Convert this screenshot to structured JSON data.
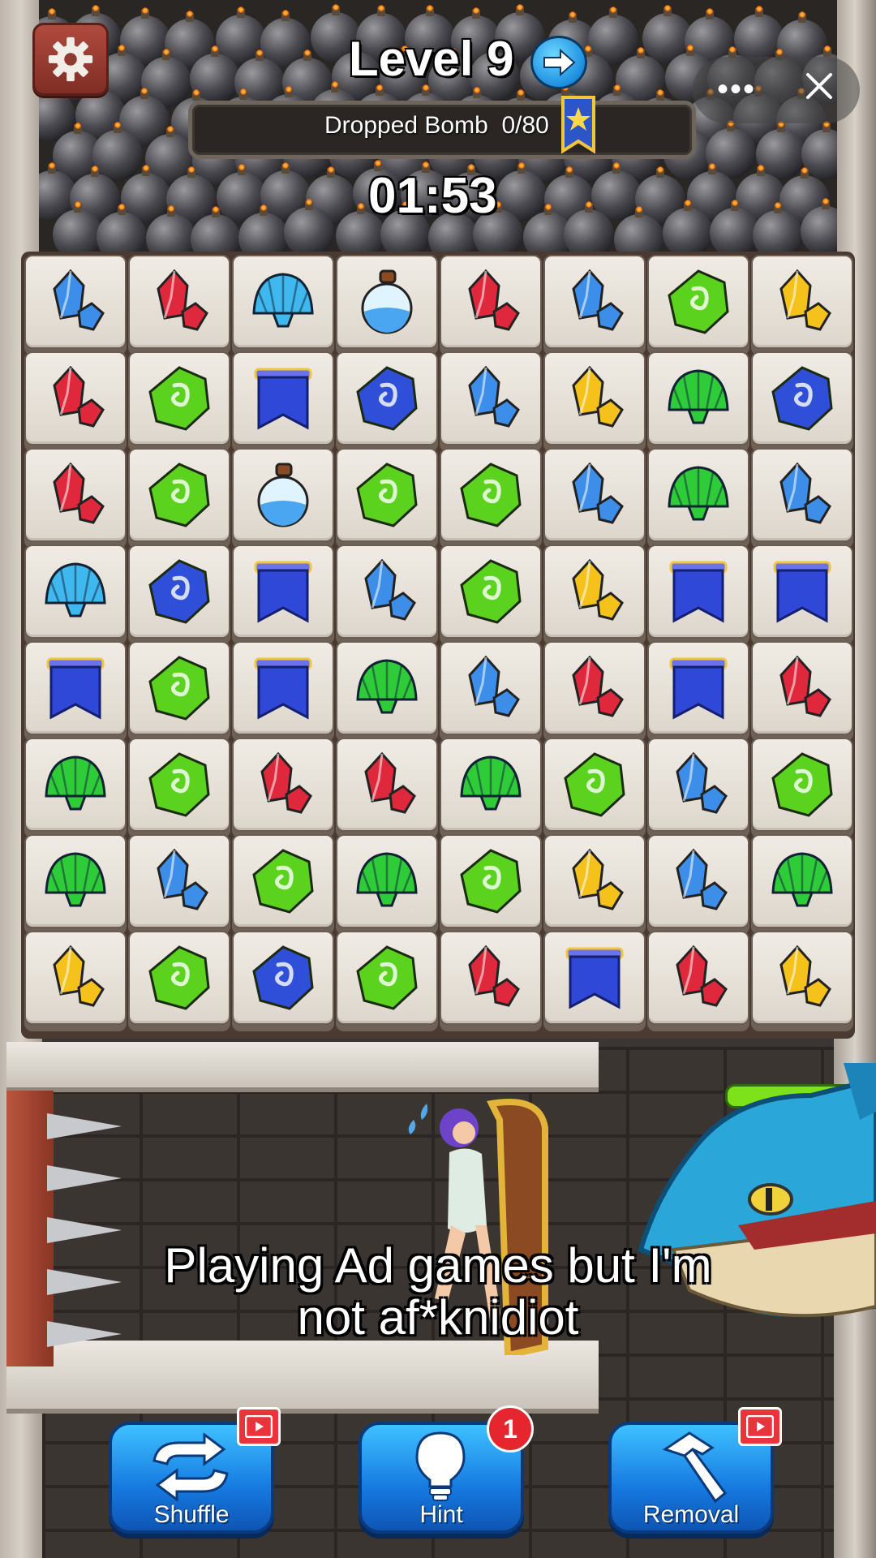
{
  "header": {
    "level_title": "Level 9",
    "progress_label": "Dropped Bomb",
    "progress_value": "0/80",
    "timer": "01:53"
  },
  "caption": {
    "line1": "Playing Ad games but I'm",
    "line2": "not af*knidiot"
  },
  "tools": {
    "shuffle_label": "Shuffle",
    "hint_label": "Hint",
    "hint_count": "1",
    "removal_label": "Removal"
  },
  "icons": {
    "settings": "gear-icon",
    "next_level": "arrow-right-icon",
    "menu": "more-dots-icon",
    "close": "close-icon",
    "ribbon": "star-ribbon-icon",
    "shuffle": "shuffle-arrows-icon",
    "hint": "lightbulb-icon",
    "removal": "hammer-icon",
    "ad": "video-ad-icon"
  },
  "board": {
    "rows": [
      [
        "blue_crystal",
        "red_crystal",
        "blue_shell",
        "blue_potion",
        "red_crystal",
        "blue_crystal",
        "green_gem",
        "yellow_crystal"
      ],
      [
        "red_crystal",
        "green_gem",
        "blue_banner",
        "blue_gem",
        "blue_crystal",
        "yellow_crystal",
        "green_shell",
        "blue_gem"
      ],
      [
        "red_crystal",
        "green_gem",
        "blue_potion",
        "green_gem",
        "green_gem",
        "blue_crystal",
        "green_shell",
        "blue_crystal"
      ],
      [
        "blue_shell",
        "blue_gem",
        "blue_banner",
        "blue_crystal",
        "green_gem",
        "yellow_crystal",
        "blue_banner",
        "blue_banner"
      ],
      [
        "blue_banner",
        "green_gem",
        "blue_banner",
        "green_shell",
        "blue_crystal",
        "red_crystal",
        "blue_banner",
        "red_crystal"
      ],
      [
        "green_shell",
        "green_gem",
        "red_crystal",
        "red_crystal",
        "green_shell",
        "green_gem",
        "blue_crystal",
        "green_gem"
      ],
      [
        "green_shell",
        "blue_crystal",
        "green_gem",
        "green_shell",
        "green_gem",
        "yellow_crystal",
        "blue_crystal",
        "green_shell"
      ],
      [
        "yellow_crystal",
        "green_gem",
        "blue_gem",
        "green_gem",
        "red_crystal",
        "blue_banner",
        "red_crystal",
        "yellow_crystal"
      ]
    ]
  },
  "colors": {
    "red_crystal": "#e0283c",
    "blue_crystal": "#3d8ee8",
    "yellow_crystal": "#f4c21a",
    "green_gem": "#5bd21e",
    "blue_gem": "#2f4fd8",
    "blue_shell": "#3fb8f0",
    "green_shell": "#2fcc3a",
    "blue_potion": "#4aa6f0",
    "blue_banner": "#3048d8",
    "button_blue": "#1679e0",
    "settings_red": "#a3443a",
    "hp_green": "#7ee21a"
  }
}
